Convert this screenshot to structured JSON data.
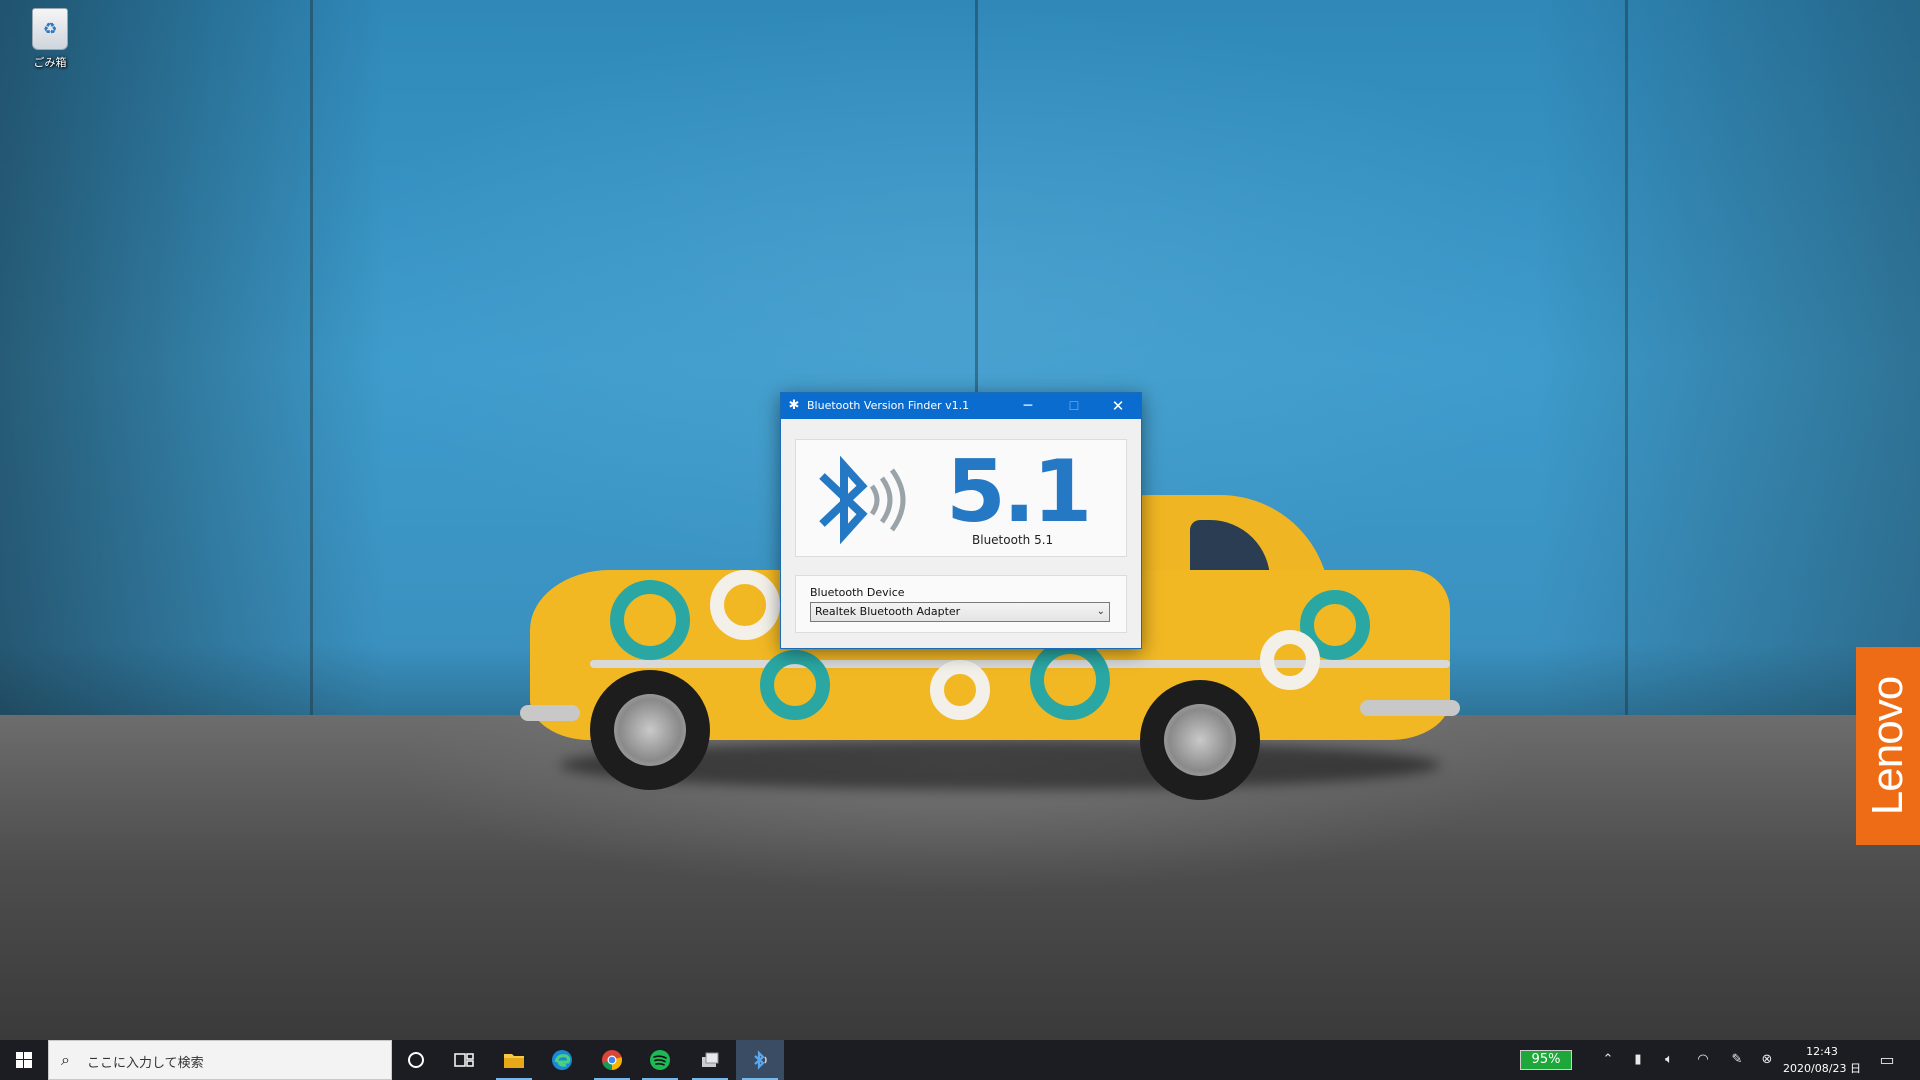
{
  "desktop": {
    "recycle_bin_label": "ごみ箱",
    "wallpaper_brand": "Lenovo"
  },
  "window": {
    "title": "Bluetooth Version Finder v1.1",
    "minimize_label": "─",
    "maximize_label": "☐",
    "close_label": "✕",
    "version_big": "5.1",
    "version_sub": "Bluetooth 5.1",
    "device_label": "Bluetooth Device",
    "device_selected": "Realtek Bluetooth Adapter",
    "accent_color": "#2478c4",
    "titlebar_color": "#0b6ccf"
  },
  "taskbar": {
    "search_placeholder": "ここに入力して検索",
    "battery_percent": "95%",
    "clock_time": "12:43",
    "clock_date": "2020/08/23 日",
    "pinned": [
      "cortana-icon",
      "task-view-icon",
      "file-explorer-icon",
      "edge-icon",
      "chrome-icon",
      "spotify-icon",
      "app-icon",
      "bluetooth-finder-icon"
    ],
    "tray": [
      "chevron-up-icon",
      "usb-icon",
      "volume-icon",
      "wifi-icon",
      "pen-icon",
      "status-icon"
    ]
  }
}
